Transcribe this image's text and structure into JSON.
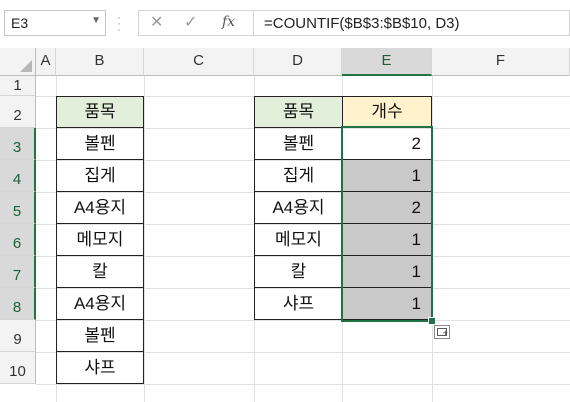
{
  "formula_bar": {
    "name_box": "E3",
    "cancel_icon": "✕",
    "enter_icon": "✓",
    "function_icon": "fx",
    "formula": "=COUNTIF($B$3:$B$10, D3)"
  },
  "columns": [
    "A",
    "B",
    "C",
    "D",
    "E",
    "F"
  ],
  "rows": [
    "1",
    "2",
    "3",
    "4",
    "5",
    "6",
    "7",
    "8",
    "9",
    "10"
  ],
  "selected": {
    "column": "E",
    "rows": [
      "3",
      "4",
      "5",
      "6",
      "7",
      "8"
    ]
  },
  "list": {
    "header": "품목",
    "items": [
      "볼펜",
      "집게",
      "A4용지",
      "메모지",
      "칼",
      "A4용지",
      "볼펜",
      "샤프"
    ]
  },
  "summary": {
    "header_item": "품목",
    "header_count": "개수",
    "rows": [
      {
        "item": "볼펜",
        "count": "2"
      },
      {
        "item": "집게",
        "count": "1"
      },
      {
        "item": "A4용지",
        "count": "2"
      },
      {
        "item": "메모지",
        "count": "1"
      },
      {
        "item": "칼",
        "count": "1"
      },
      {
        "item": "샤프",
        "count": "1"
      }
    ]
  },
  "colors": {
    "accent": "#217346",
    "header_green": "#e2efda",
    "header_yellow": "#fff2cc",
    "selection_gray": "#c9c9c9"
  }
}
